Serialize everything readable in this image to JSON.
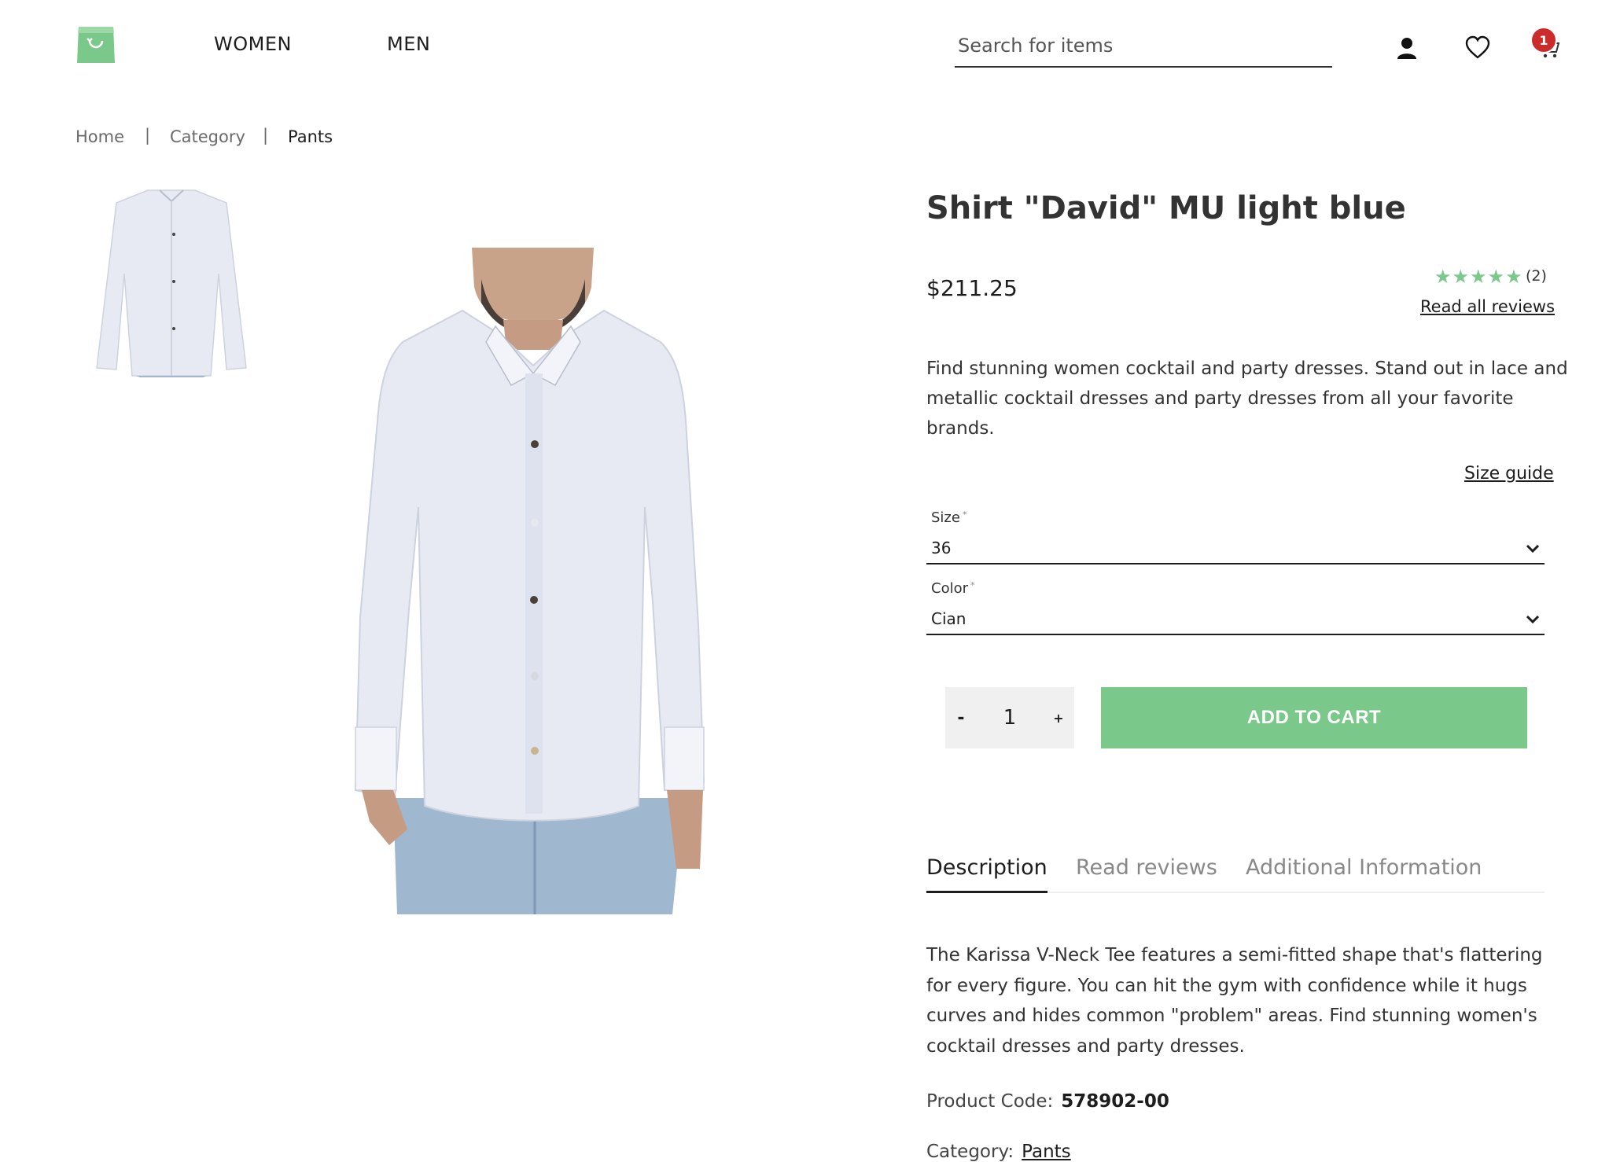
{
  "header": {
    "nav": [
      "WOMEN",
      "MEN"
    ],
    "search_placeholder": "Search for items",
    "cart_count": "1"
  },
  "breadcrumb": {
    "items": [
      "Home",
      "Category",
      "Pants"
    ],
    "separator": "|"
  },
  "product": {
    "title": "Shirt \"David\" MU light blue",
    "price": "$211.25",
    "rating_stars": "★★★★★",
    "review_count": "(2)",
    "read_all_reviews": "Read all reviews",
    "short_description": "Find stunning women cocktail and party dresses. Stand out in lace and metallic cocktail dresses and party dresses from all your favorite brands.",
    "size_guide": "Size guide",
    "size_label": "Size",
    "size_value": "36",
    "color_label": "Color",
    "color_value": "Cian",
    "required_mark": "*",
    "quantity": "1",
    "qty_minus": "-",
    "qty_plus": "+",
    "add_to_cart": "ADD TO CART"
  },
  "tabs": [
    "Description",
    "Read reviews",
    "Additional Information"
  ],
  "details": {
    "long_description": "The Karissa V-Neck Tee features a semi-fitted shape that's flattering for every figure. You can hit the gym with confidence while it hugs curves and hides common \"problem\" areas. Find stunning women's cocktail dresses and party dresses.",
    "product_code_label": "Product Code:",
    "product_code": "578902-00",
    "category_label": "Category:",
    "category_value": "Pants"
  },
  "colors": {
    "accent": "#7bc98a",
    "badge": "#cc2b2b",
    "text": "#1d1d1d",
    "shirt": "#e7eaf3",
    "jeans": "#9fb7cf"
  },
  "icons": [
    "shopping-bag-logo-icon",
    "user-icon",
    "heart-icon",
    "cart-icon",
    "chevron-down-icon"
  ]
}
